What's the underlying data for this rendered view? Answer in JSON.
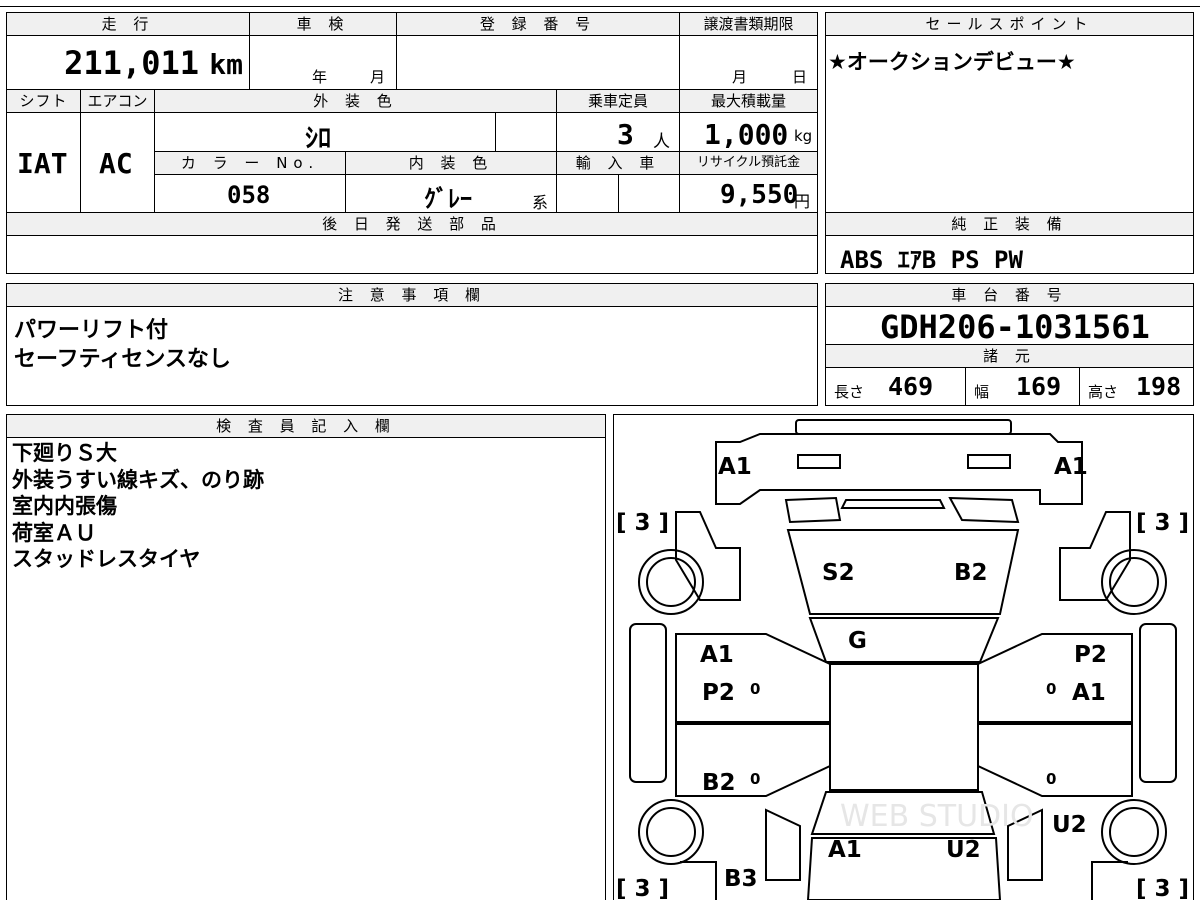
{
  "mileage": {
    "label": "走 行",
    "value": "211,011",
    "unit": "km"
  },
  "inspection": {
    "label": "車 検",
    "year": "年",
    "month": "月"
  },
  "registration": {
    "label": "登 録 番 号",
    "value": ""
  },
  "transfer_deadline": {
    "label": "譲渡書類期限",
    "month": "月",
    "day": "日"
  },
  "sales_point": {
    "label": "セールスポイント",
    "text": "★オークションデビュー★"
  },
  "shift": {
    "label": "シフト",
    "value": "IAT"
  },
  "aircon": {
    "label": "エアコン",
    "value": "AC"
  },
  "exterior_color": {
    "label": "外 装 色",
    "value": "ｼﾛ"
  },
  "capacity": {
    "label": "乗車定員",
    "value": "3",
    "unit": "人"
  },
  "max_load": {
    "label": "最大積載量",
    "value": "1,000",
    "unit": "kg"
  },
  "color_no": {
    "label": "カ ラ ー No.",
    "value": "058"
  },
  "interior_color": {
    "label": "内 装 色",
    "value": "ｸﾞﾚｰ",
    "suffix": "系"
  },
  "import": {
    "label": "輸 入 車",
    "value": ""
  },
  "recycle_fee": {
    "label": "リサイクル預託金",
    "value": "9,550",
    "unit": "円"
  },
  "later_parts": {
    "label": "後 日 発 送 部 品",
    "value": ""
  },
  "genuine_equipment": {
    "label": "純 正 装 備",
    "value": "ABS ｴｱB PS PW"
  },
  "notes": {
    "label": "注 意 事 項 欄",
    "lines": [
      "パワーリフト付",
      "セーフティセンスなし"
    ]
  },
  "chassis_number": {
    "label": "車 台 番 号",
    "value": "GDH206-1031561"
  },
  "specs": {
    "label": "諸 元",
    "length_label": "長さ",
    "length": "469",
    "width_label": "幅",
    "width": "169",
    "height_label": "高さ",
    "height": "198"
  },
  "inspector": {
    "label": "検 査 員 記 入 欄",
    "lines": [
      "下廻りＳ大",
      "外装うすい線キズ、のり跡",
      "室内内張傷",
      "荷室ＡＵ",
      "スタッドレスタイヤ"
    ]
  },
  "diagram": {
    "tire_marks": [
      "[ 3 ]",
      "[ 3 ]",
      "[ 3 ]",
      "[ 3 ]"
    ],
    "labels": {
      "front_left": "A1",
      "front_right": "A1",
      "hood_left": "S2",
      "hood_right": "B2",
      "windshield": "G",
      "door_fl_1": "A1",
      "door_fl_2": "P2",
      "door_fr_1": "P2",
      "door_fr_2": "A1",
      "door_rl": "B2",
      "rear_right": "U2",
      "rear_left": "B3",
      "tail_left": "A1",
      "tail_right": "U2"
    },
    "zeros": [
      "0",
      "0",
      "0",
      "0"
    ],
    "watermark": "WEB STUDIO"
  }
}
